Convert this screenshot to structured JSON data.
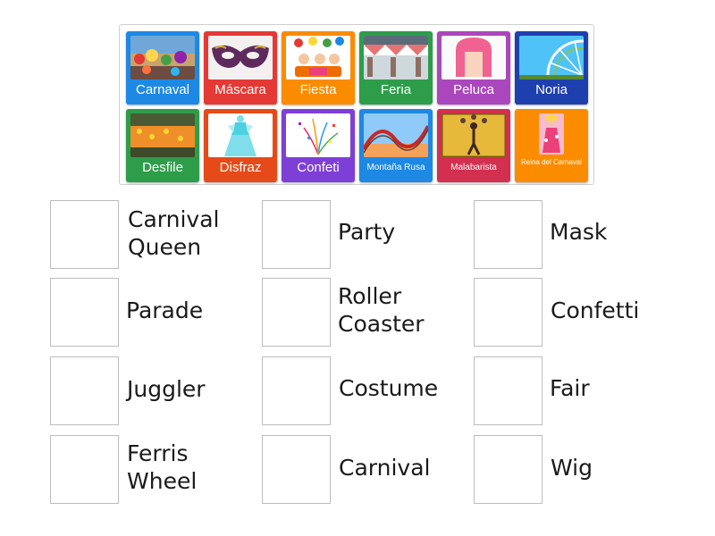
{
  "cards": [
    {
      "label": "Carnaval",
      "color": "#1e88e5",
      "icon": "carnival-crowd-photo"
    },
    {
      "label": "Máscara",
      "color": "#e53935",
      "icon": "mask-photo"
    },
    {
      "label": "Fiesta",
      "color": "#fb8c00",
      "icon": "party-kids-photo"
    },
    {
      "label": "Feria",
      "color": "#2e9d4a",
      "icon": "fair-tents-photo"
    },
    {
      "label": "Peluca",
      "color": "#ab47bc",
      "icon": "pink-wig-photo"
    },
    {
      "label": "Noria",
      "color": "#1e3fae",
      "icon": "ferris-wheel-photo"
    },
    {
      "label": "Desfile",
      "color": "#2e9d4a",
      "icon": "parade-photo"
    },
    {
      "label": "Disfraz",
      "color": "#e64a19",
      "icon": "costume-photo"
    },
    {
      "label": "Confeti",
      "color": "#7e3fd6",
      "icon": "confetti-photo"
    },
    {
      "label": "Montaña Rusa",
      "color": "#1e88e5",
      "icon": "roller-coaster-photo"
    },
    {
      "label": "Malabarista",
      "color": "#d32f4f",
      "icon": "juggler-photo"
    },
    {
      "label": "Reina del Carnaval",
      "color": "#fb8c00",
      "icon": "carnival-queen-photo"
    }
  ],
  "words": [
    "Carnival Queen",
    "Party",
    "Mask",
    "Parade",
    "Roller Coaster",
    "Confetti",
    "Juggler",
    "Costume",
    "Fair",
    "Ferris Wheel",
    "Carnival",
    "Wig"
  ]
}
